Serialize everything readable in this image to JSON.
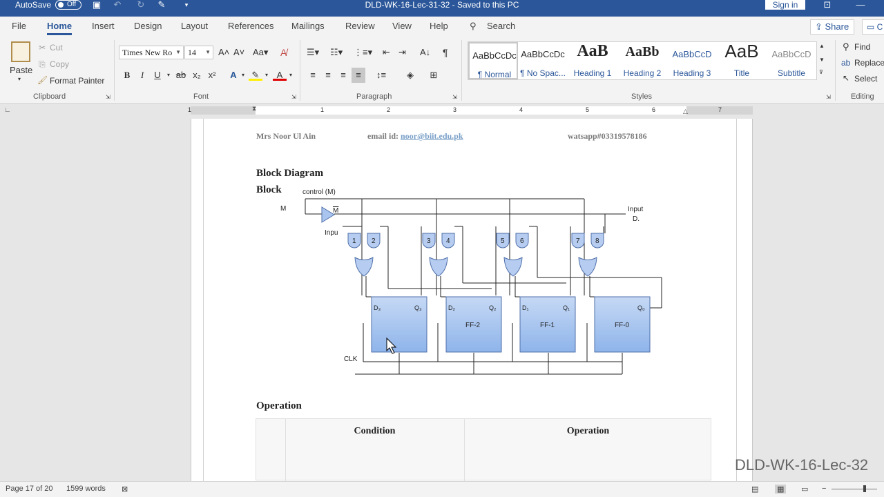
{
  "titlebar": {
    "autosave_label": "AutoSave",
    "autosave_state": "Off",
    "document_title": "DLD-WK-16-Lec-31-32  -  Saved to this PC",
    "signin_label": "Sign in",
    "accent_color": "#2b579a"
  },
  "tabs": {
    "items": [
      {
        "label": "File"
      },
      {
        "label": "Home"
      },
      {
        "label": "Insert"
      },
      {
        "label": "Design"
      },
      {
        "label": "Layout"
      },
      {
        "label": "References"
      },
      {
        "label": "Mailings"
      },
      {
        "label": "Review"
      },
      {
        "label": "View"
      },
      {
        "label": "Help"
      }
    ],
    "active": "Home",
    "search_label": "Search",
    "share_label": "Share",
    "comments_label": "C"
  },
  "ribbon": {
    "clipboard": {
      "paste": "Paste",
      "cut": "Cut",
      "copy": "Copy",
      "format_painter": "Format Painter",
      "group_label": "Clipboard"
    },
    "font": {
      "font_name": "Times New Ro",
      "font_size": "14",
      "bold": "B",
      "italic": "I",
      "underline": "U",
      "strikethrough": "ab",
      "subscript": "x₂",
      "superscript": "x²",
      "group_label": "Font"
    },
    "paragraph": {
      "group_label": "Paragraph"
    },
    "styles": {
      "items": [
        {
          "sample": "AaBbCcDc",
          "name": "¶ Normal"
        },
        {
          "sample": "AaBbCcDc",
          "name": "¶ No Spac..."
        },
        {
          "sample": "AaB",
          "name": "Heading 1"
        },
        {
          "sample": "AaBb",
          "name": "Heading 2"
        },
        {
          "sample": "AaBbCcD",
          "name": "Heading 3"
        },
        {
          "sample": "AaB",
          "name": "Title"
        },
        {
          "sample": "AaBbCcD",
          "name": "Subtitle"
        }
      ],
      "group_label": "Styles"
    },
    "editing": {
      "find": "Find",
      "replace": "Replace",
      "select": "Select",
      "group_label": "Editing"
    }
  },
  "ruler": {
    "numbers": [
      "1",
      "1",
      "2",
      "3",
      "4",
      "5",
      "6",
      "7"
    ]
  },
  "document": {
    "header": {
      "author": "Mrs Noor Ul Ain",
      "email_label": "email id:",
      "email": "noor@biit.edu.pk",
      "whatsapp": "watsapp#03319578186"
    },
    "heading_block_diagram": "Block Diagram",
    "heading_block_partial": "Block",
    "diagram": {
      "mode_control": "control (M)",
      "m_label": "M",
      "m_bar": "M",
      "input_right": "Input",
      "input_right_sub": "D.",
      "input_left": "Inpu",
      "clk": "CLK",
      "gates": [
        "1",
        "2",
        "3",
        "4",
        "5",
        "6",
        "7",
        "8"
      ],
      "flipflops": [
        {
          "name": "",
          "d": "D₃",
          "q": "Q₃"
        },
        {
          "name": "FF-2",
          "d": "D₂",
          "q": "Q₂"
        },
        {
          "name": "FF-1",
          "d": "D₁",
          "q": "Q₁"
        },
        {
          "name": "FF-0",
          "d": "",
          "q": "Q₀"
        }
      ]
    },
    "heading_operation": "Operation",
    "table": {
      "headers": [
        "Condition",
        "Operation"
      ]
    }
  },
  "statusbar": {
    "page": "Page 17 of 20",
    "words": "1599 words"
  },
  "watermark": "DLD-WK-16-Lec-32"
}
